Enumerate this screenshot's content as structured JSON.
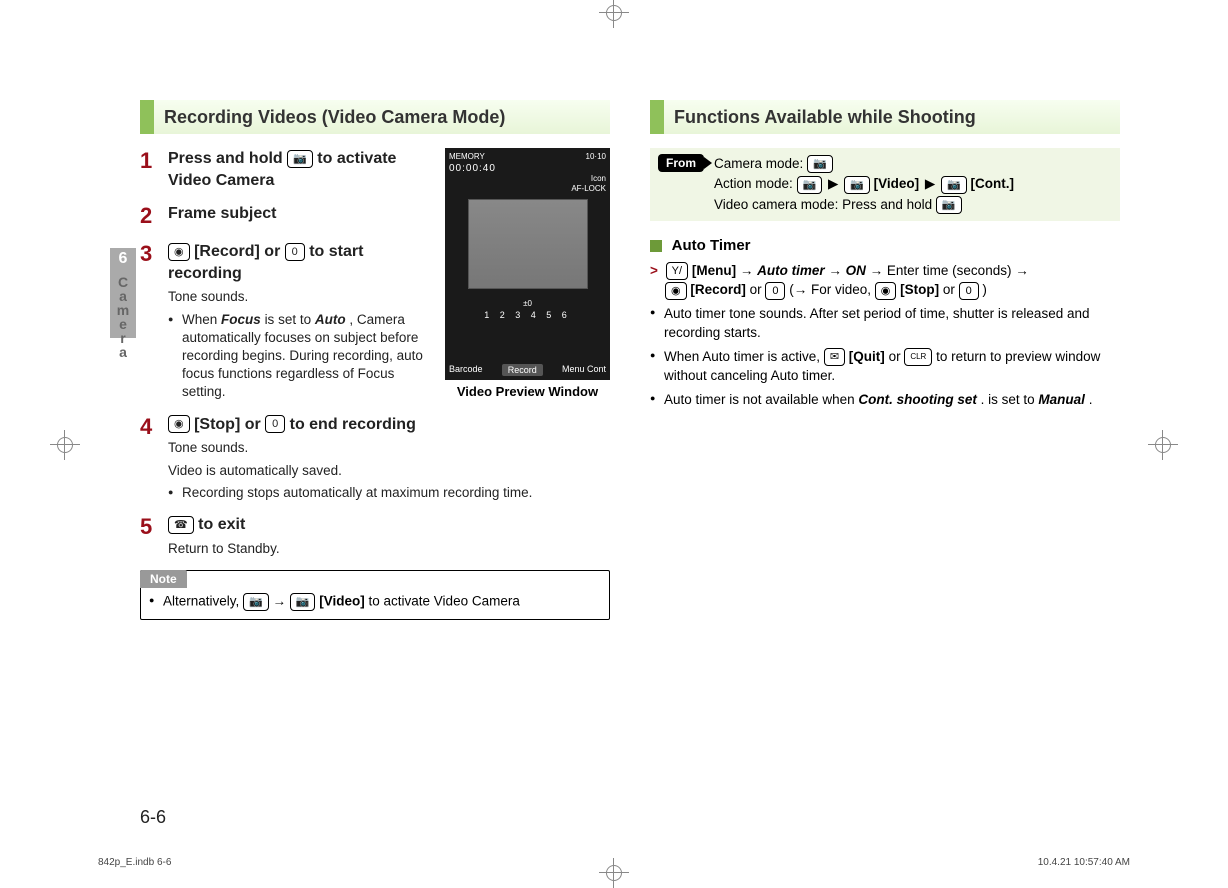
{
  "chapter": {
    "number": "6",
    "label": "Camera"
  },
  "page_number": "6-6",
  "footer": {
    "file": "842p_E.indb   6-6",
    "timestamp": "10.4.21   10:57:40 AM"
  },
  "left": {
    "heading": "Recording Videos (Video Camera Mode)",
    "preview_caption": "Video Preview Window",
    "screen": {
      "status_left": "MEMORY",
      "status_right": "10·10",
      "timer": "00:00:40",
      "icon_label": "Icon",
      "aflock": "AF-LOCK",
      "row": "±0",
      "numbers": "1 2 3 4 5 6",
      "softkeys": {
        "left": "Barcode",
        "center": "Record",
        "right": "Menu Cont"
      }
    },
    "steps": {
      "1": {
        "title_before": "Press and hold ",
        "title_after": " to activate Video Camera",
        "key": "📷"
      },
      "2": {
        "title": "Frame subject"
      },
      "3": {
        "key_circle": "◉",
        "title_mid": "[Record] or ",
        "key_zero": "0",
        "title_after": " to start recording",
        "desc_1": "Tone sounds.",
        "bullet_before": "When ",
        "focus": "Focus",
        "bullet_mid": " is set to ",
        "auto": "Auto",
        "bullet_after": ", Camera automatically focuses on subject before recording begins. During recording, auto focus functions regardless of Focus setting."
      },
      "4": {
        "key_circle": "◉",
        "title_mid": "[Stop] or ",
        "key_zero": "0",
        "title_after": " to end recording",
        "desc_1": "Tone sounds.",
        "desc_2": "Video is automatically saved.",
        "bullet_1": "Recording stops automatically at maximum recording time."
      },
      "5": {
        "key": "☎",
        "title_after": " to exit",
        "desc_1": "Return to Standby."
      }
    },
    "note": {
      "label": "Note",
      "text_before": "Alternatively, ",
      "key1": "📷",
      "arrow": " → ",
      "key2": "📷",
      "key2_label": "[Video]",
      "text_after": " to activate Video Camera"
    }
  },
  "right": {
    "heading": "Functions Available while Shooting",
    "from": {
      "label": "From",
      "line1_before": "Camera mode: ",
      "line1_key": "📷",
      "line2_before": "Action mode: ",
      "line2_k1": "📷",
      "line2_k2": "📷",
      "line2_k2_label": "[Video]",
      "line2_k3": "📷",
      "line2_k3_label": "[Cont.]",
      "line3_before": "Video camera mode: Press and hold ",
      "line3_key": "📷"
    },
    "topic": {
      "title": "Auto Timer",
      "l1_k1": "Y/",
      "l1_k1_label": "[Menu]",
      "l1_arrow": " → ",
      "l1_autotimer": "Auto timer",
      "l1_on": "ON",
      "l1_after_on": " → Enter time (seconds) → ",
      "l2_k1": "◉",
      "l2_k1_label": "[Record]",
      "l2_or": " or ",
      "l2_k2": "0",
      "l2_paren_open": " (→ For video, ",
      "l2_k3": "◉",
      "l2_k3_label": "[Stop]",
      "l2_k4": "0",
      "l2_paren_close": ")",
      "b1": "Auto timer tone sounds. After set period of time, shutter is released and recording starts.",
      "b2_before": "When Auto timer is active, ",
      "b2_k1": "✉",
      "b2_k1_label": "[Quit]",
      "b2_or": " or ",
      "b2_k2": "CLR",
      "b2_after": " to return to preview window without canceling Auto timer.",
      "b3_before": "Auto timer is not available when ",
      "b3_em1": "Cont. shooting set",
      "b3_mid": ". is set to ",
      "b3_em2": "Manual",
      "b3_after": "."
    }
  }
}
